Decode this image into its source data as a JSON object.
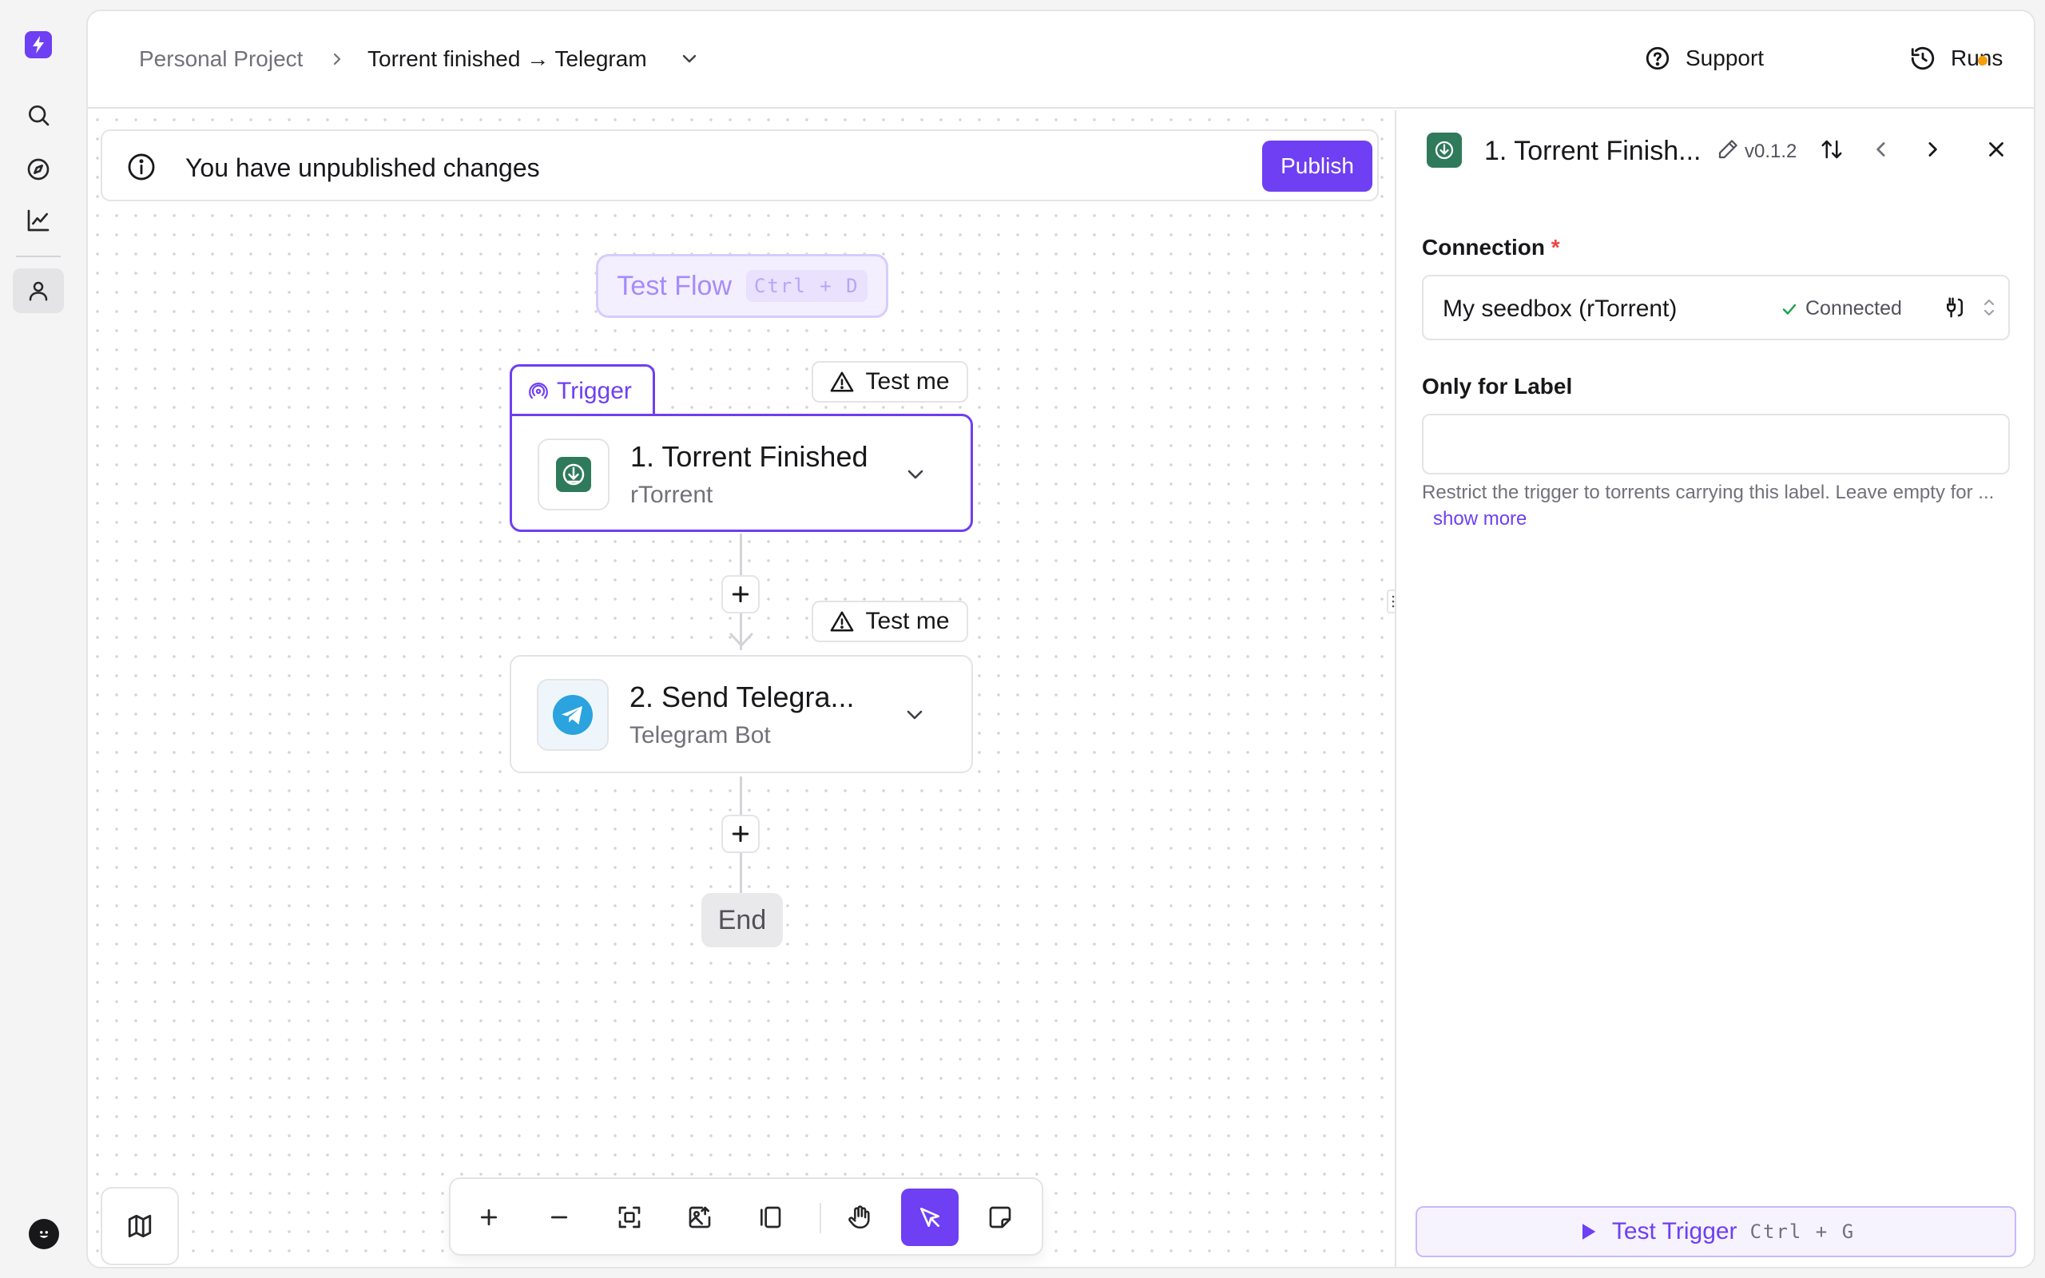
{
  "breadcrumb": {
    "project": "Personal Project",
    "flow": "Torrent finished → Telegram"
  },
  "header": {
    "support_label": "Support",
    "runs_label": "Runs"
  },
  "banner": {
    "message": "You have unpublished changes",
    "publish_label": "Publish"
  },
  "canvas": {
    "test_flow_label": "Test Flow",
    "test_flow_shortcut": "Ctrl + D",
    "trigger_tab_label": "Trigger",
    "test_me_label": "Test me",
    "steps": [
      {
        "title": "1. Torrent Finished",
        "subtitle": "rTorrent"
      },
      {
        "title": "2. Send Telegra...",
        "subtitle": "Telegram Bot"
      }
    ],
    "end_label": "End"
  },
  "panel": {
    "title": "1. Torrent Finish...",
    "version": "v0.1.2",
    "connection_label": "Connection",
    "required_mark": "*",
    "connection_value": "My seedbox (rTorrent)",
    "connection_status": "Connected",
    "label_field_label": "Only for Label",
    "label_field_value": "",
    "help_text": "Restrict the trigger to torrents carrying this label. Leave empty for ...",
    "show_more": "show more",
    "test_trigger_label": "Test Trigger",
    "test_trigger_shortcut": "Ctrl + G"
  },
  "colors": {
    "accent": "#6e3ff3",
    "status_dot": "#f59e0b",
    "connected_check": "#16a34a",
    "rtorrent_icon": "#2f7a5b",
    "telegram_icon": "#2aa3df"
  },
  "icons": {
    "rail": [
      "logo-bolt-icon",
      "search-icon",
      "compass-icon",
      "chart-icon",
      "user-icon"
    ],
    "toolbar": [
      "zoom-in-icon",
      "zoom-out-icon",
      "fit-view-icon",
      "export-image-icon",
      "layout-icon",
      "hand-icon",
      "pointer-icon",
      "note-icon"
    ]
  }
}
